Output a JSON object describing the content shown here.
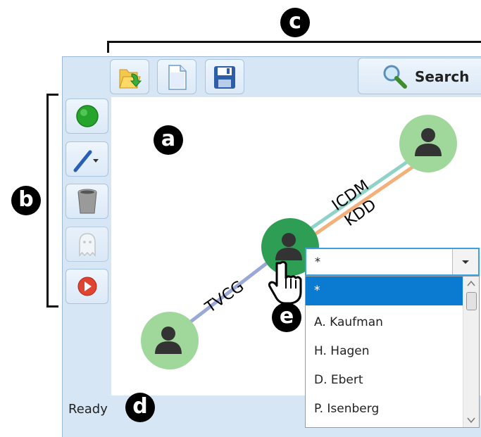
{
  "annotations": {
    "a": "a",
    "b": "b",
    "c": "c",
    "d": "d",
    "e": "e"
  },
  "toolbar": {
    "open_icon": "folder-open-icon",
    "new_icon": "new-document-icon",
    "save_icon": "save-disk-icon",
    "search_label": "Search",
    "search_icon": "magnifier-icon"
  },
  "sidebar": {
    "tools": [
      {
        "name": "add-node",
        "icon": "green-circle-icon"
      },
      {
        "name": "draw-edge",
        "icon": "pen-dropdown-icon"
      },
      {
        "name": "delete",
        "icon": "trash-can-icon"
      },
      {
        "name": "ghost",
        "icon": "ghost-icon"
      },
      {
        "name": "play",
        "icon": "play-icon"
      }
    ]
  },
  "graph": {
    "edge_labels": [
      "ICDM",
      "KDD",
      "TVCG"
    ],
    "colors": {
      "node_light": "#9fd89a",
      "node_dark": "#2f9e55",
      "edge_teal": "#8fd3c8",
      "edge_orange": "#f3b07a",
      "edge_blue": "#9aa8d8"
    }
  },
  "status": {
    "text": "Ready"
  },
  "combobox": {
    "value": "*",
    "options": [
      "*",
      "A. Kaufman",
      "H. Hagen",
      "D. Ebert",
      "P. Isenberg"
    ],
    "selected_index": 0
  }
}
